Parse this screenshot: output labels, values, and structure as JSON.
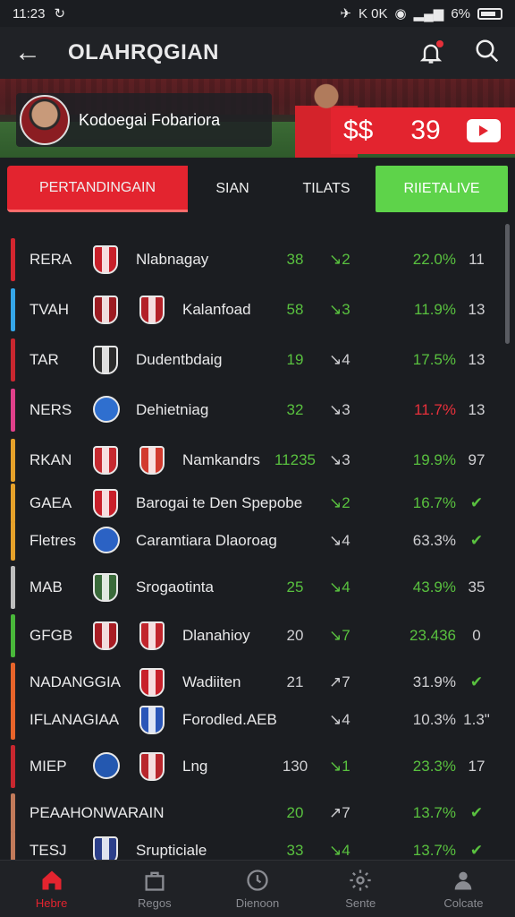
{
  "status": {
    "time": "11:23",
    "net": "K 0K",
    "battery": "6%"
  },
  "appbar": {
    "title": "OLAHRQGIAN"
  },
  "banner": {
    "profile_name": "Kodoegai Fobariora",
    "currency": "$$",
    "score": "39"
  },
  "tabs": [
    {
      "label": "PERTANDINGAIN"
    },
    {
      "label": "SIAN"
    },
    {
      "label": "TILATS"
    },
    {
      "label": "RIIETALIVE"
    }
  ],
  "rows": [
    {
      "abbr": "RERA",
      "name": "Nlabnagay",
      "num": "38",
      "arrow": "↘2",
      "pct": "22.0%",
      "last": "11",
      "bar": "#d3262f",
      "num_color": "green",
      "arrow_color": "green",
      "pct_color": "green",
      "last_color": "muted",
      "badge1": "#c8202a",
      "badge2": null
    },
    {
      "abbr": "TVAH",
      "name": "Kalanfoad",
      "num": "58",
      "arrow": "↘3",
      "pct": "11.9%",
      "last": "13",
      "bar": "#35a6e8",
      "num_color": "green",
      "arrow_color": "green",
      "pct_color": "green",
      "last_color": "muted",
      "badge1": "#9c1c22",
      "badge2": "#b32128"
    },
    {
      "abbr": "TAR",
      "name": "Dudentbdaig",
      "num": "19",
      "arrow": "↘4",
      "pct": "17.5%",
      "last": "13",
      "bar": "#c8272f",
      "num_color": "green",
      "arrow_color": "muted",
      "pct_color": "green",
      "last_color": "muted",
      "badge1": "#2c2c2c",
      "badge2": null
    },
    {
      "abbr": "NERS",
      "name": "Dehietniag",
      "num": "32",
      "arrow": "↘3",
      "pct": "11.7%",
      "last": "13",
      "bar": "#e0408a",
      "num_color": "green",
      "arrow_color": "muted",
      "pct_color": "red",
      "last_color": "muted",
      "badge1": "#2f6fcf",
      "badge2": null
    },
    {
      "abbr": "RKAN",
      "name": "Namkandrs",
      "num": "11235",
      "arrow": "↘3",
      "pct": "19.9%",
      "last": "97",
      "bar": "#e6a12a",
      "num_color": "green",
      "arrow_color": "muted",
      "pct_color": "green",
      "last_color": "muted",
      "badge1": "#c62a30",
      "badge2": "#d23a2e"
    },
    {
      "abbr": "GAEA",
      "name": "Barogai te Den Spepobe",
      "num": "",
      "arrow": "↘2",
      "pct": "16.7%",
      "last": "✔",
      "bar": "#e6a12a",
      "num_color": "green",
      "arrow_color": "green",
      "pct_color": "green",
      "last_color": "green",
      "badge1": "#c81f2a",
      "badge2": null
    },
    {
      "abbr": "Fletres",
      "name": "Caramtiara Dlaoroag",
      "num": "",
      "arrow": "↘4",
      "pct": "63.3%",
      "last": "✔",
      "bar": "#e6a12a",
      "num_color": "green",
      "arrow_color": "muted",
      "pct_color": "muted",
      "last_color": "green",
      "badge1": "#2b62c4",
      "badge2": null
    },
    {
      "abbr": "MAB",
      "name": "Srogaotinta",
      "num": "25",
      "arrow": "↘4",
      "pct": "43.9%",
      "last": "35",
      "bar": "#bdbdbd",
      "num_color": "green",
      "arrow_color": "green",
      "pct_color": "green",
      "last_color": "muted",
      "badge1": "#3a6a3a",
      "badge2": null
    },
    {
      "abbr": "GFGB",
      "name": "Dlanahioy",
      "num": "20",
      "arrow": "↘7",
      "pct": "23.436",
      "last": "0",
      "bar": "#49b83a",
      "num_color": "muted",
      "arrow_color": "green",
      "pct_color": "green",
      "last_color": "muted",
      "badge1": "#a81d24",
      "badge2": "#c1252c"
    },
    {
      "abbr": "NADANGGIA",
      "name": "Wadiiten",
      "num": "21",
      "arrow": "↗7",
      "pct": "31.9%",
      "last": "✔",
      "bar": "#e8642a",
      "num_color": "muted",
      "arrow_color": "muted",
      "pct_color": "muted",
      "last_color": "green",
      "badge1": null,
      "badge2": "#c8202a"
    },
    {
      "abbr": "IFLANAGIAA",
      "name": "Forodled.AEB",
      "num": "",
      "arrow": "↘4",
      "pct": "10.3%",
      "last": "1.3ʺ",
      "bar": "#e8642a",
      "num_color": "muted",
      "arrow_color": "muted",
      "pct_color": "muted",
      "last_color": "muted",
      "badge1": null,
      "badge2": "#2a56b8"
    },
    {
      "abbr": "MIEP",
      "name": "Lng",
      "num": "130",
      "arrow": "↘1",
      "pct": "23.3%",
      "last": "17",
      "bar": "#c8272f",
      "num_color": "muted",
      "arrow_color": "green",
      "pct_color": "green",
      "last_color": "muted",
      "badge1": "#2458b0",
      "badge2": "#b8262c"
    },
    {
      "abbr": "PEAAHONWARAIN",
      "name": "",
      "num": "20",
      "arrow": "↗7",
      "pct": "13.7%",
      "last": "✔",
      "bar": "#c27a5a",
      "num_color": "green",
      "arrow_color": "muted",
      "pct_color": "green",
      "last_color": "green",
      "badge1": null,
      "badge2": null
    },
    {
      "abbr": "TESJ",
      "name": "Srupticiale",
      "num": "33",
      "arrow": "↘4",
      "pct": "13.7%",
      "last": "✔",
      "bar": "#c27a5a",
      "num_color": "green",
      "arrow_color": "green",
      "pct_color": "green",
      "last_color": "green",
      "badge1": "#2c3f8a",
      "badge2": null
    }
  ],
  "nav": [
    {
      "label": "Hebre",
      "icon": "home-icon"
    },
    {
      "label": "Regos",
      "icon": "bag-icon"
    },
    {
      "label": "Dienoon",
      "icon": "clock-icon"
    },
    {
      "label": "Sente",
      "icon": "gear-icon"
    },
    {
      "label": "Colcate",
      "icon": "user-icon"
    }
  ]
}
